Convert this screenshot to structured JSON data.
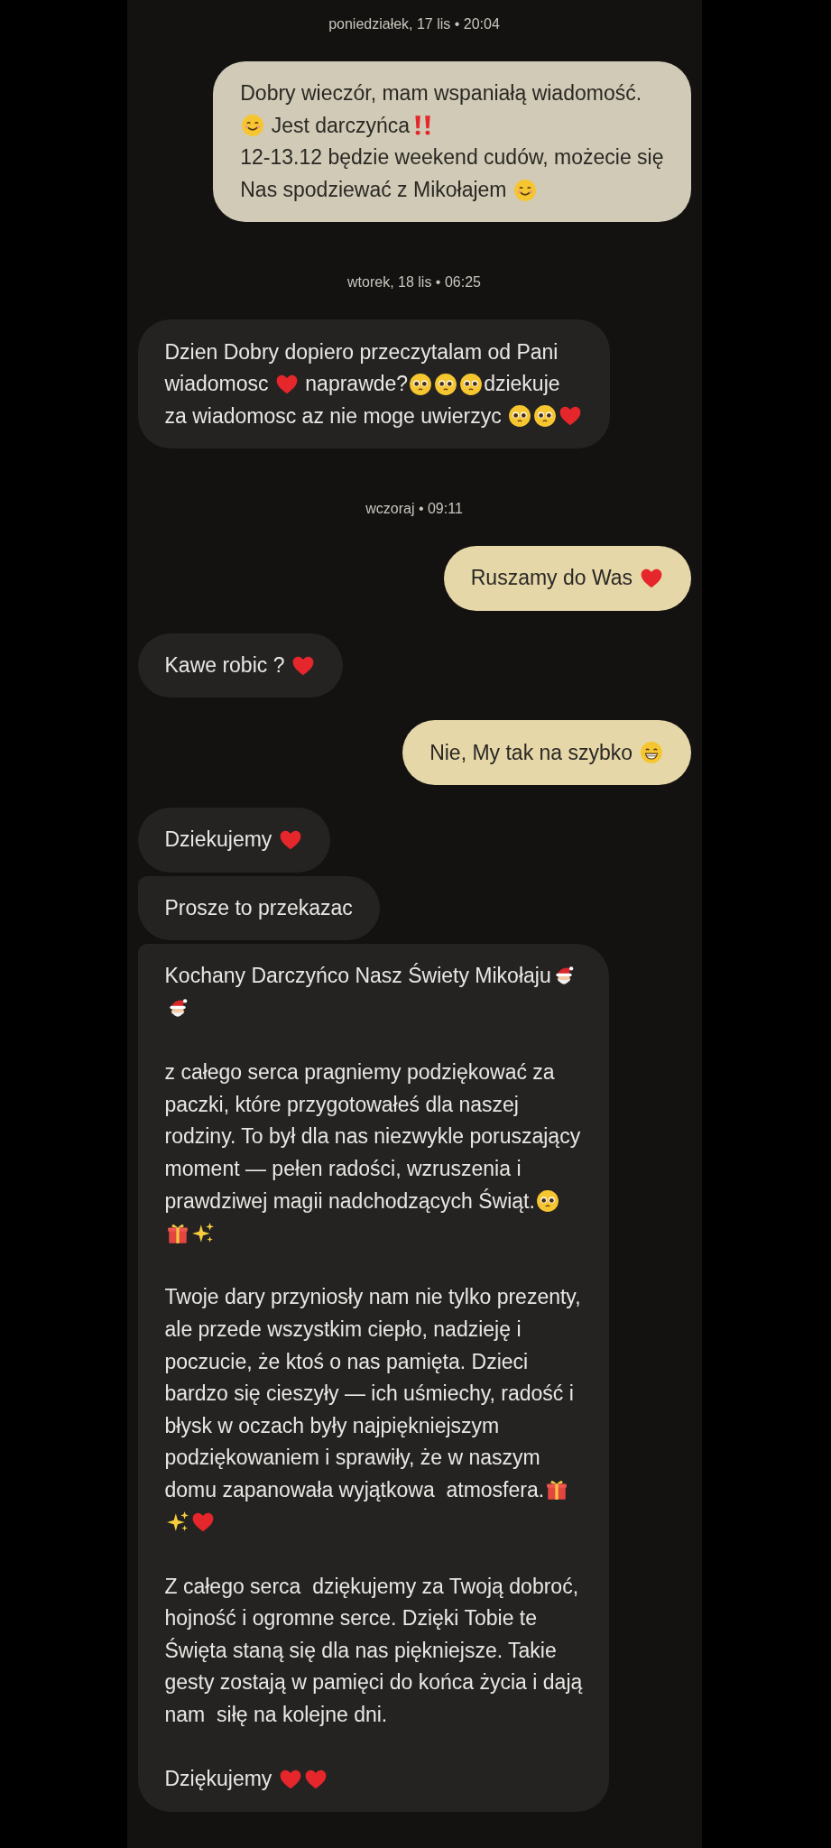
{
  "items": [
    {
      "kind": "date",
      "text": "poniedziałek, 17 lis • 20:04"
    },
    {
      "kind": "message",
      "outgoing": true,
      "color": "#d1cab6",
      "paragraphs": [
        [
          [
            {
              "kind": "text",
              "text": "Dobry wieczór, mam wspaniałą wiadomość."
            }
          ],
          [
            {
              "kind": "smile"
            },
            {
              "kind": "text",
              "text": " Jest darczyńca"
            },
            {
              "kind": "exclamation"
            }
          ],
          [
            {
              "kind": "text",
              "text": "12-13.12 będzie weekend cudów, możecie się"
            }
          ],
          [
            {
              "kind": "text",
              "text": "Nas spodziewać z Mikołajem "
            },
            {
              "kind": "smile"
            }
          ]
        ]
      ]
    },
    {
      "kind": "date",
      "text": "wtorek, 18 lis • 06:25"
    },
    {
      "kind": "message",
      "outgoing": false,
      "color": "#242322",
      "paragraphs": [
        [
          [
            {
              "kind": "text",
              "text": "Dzien Dobry dopiero przeczytalam od Pani"
            }
          ],
          [
            {
              "kind": "text",
              "text": "wiadomosc "
            },
            {
              "kind": "heart"
            },
            {
              "kind": "text",
              "text": " naprawde?"
            },
            {
              "kind": "pleading"
            },
            {
              "kind": "pleading"
            },
            {
              "kind": "pleading"
            },
            {
              "kind": "text",
              "text": "dziekuje"
            }
          ],
          [
            {
              "kind": "text",
              "text": "za wiadomosc az nie moge uwierzyc "
            },
            {
              "kind": "pleading"
            },
            {
              "kind": "pleading"
            },
            {
              "kind": "heart"
            }
          ]
        ]
      ]
    },
    {
      "kind": "date",
      "text": "wczoraj • 09:11"
    },
    {
      "kind": "message",
      "outgoing": true,
      "color": "#e6d7a9",
      "paragraphs": [
        [
          [
            {
              "kind": "text",
              "text": "Ruszamy do Was "
            },
            {
              "kind": "heart"
            }
          ]
        ]
      ]
    },
    {
      "kind": "message",
      "outgoing": false,
      "color": "#242322",
      "paragraphs": [
        [
          [
            {
              "kind": "text",
              "text": "Kawe robic ? "
            },
            {
              "kind": "heart"
            }
          ]
        ]
      ]
    },
    {
      "kind": "message",
      "outgoing": true,
      "color": "#e6d7a9",
      "paragraphs": [
        [
          [
            {
              "kind": "text",
              "text": "Nie, My tak na szybko "
            },
            {
              "kind": "grin"
            }
          ]
        ]
      ]
    },
    {
      "kind": "message",
      "outgoing": false,
      "color": "#242322",
      "paragraphs": [
        [
          [
            {
              "kind": "text",
              "text": "Dziekujemy "
            },
            {
              "kind": "heart"
            }
          ]
        ]
      ]
    },
    {
      "kind": "message",
      "outgoing": false,
      "color": "#242322",
      "paragraphs": [
        [
          [
            {
              "kind": "text",
              "text": "Prosze to przekazac"
            }
          ]
        ]
      ]
    },
    {
      "kind": "message",
      "outgoing": false,
      "color": "#242322",
      "paragraphs": [
        [
          [
            {
              "kind": "text",
              "text": "Kochany Darczyńco Nasz Świety Mikołaju"
            },
            {
              "kind": "santa"
            }
          ],
          [
            {
              "kind": "santa"
            }
          ]
        ],
        [
          [
            {
              "kind": "text",
              "text": "z całego serca pragniemy podziękować za"
            }
          ],
          [
            {
              "kind": "text",
              "text": "paczki, które przygotowałeś dla naszej"
            }
          ],
          [
            {
              "kind": "text",
              "text": "rodziny. To był dla nas niezwykle poruszający"
            }
          ],
          [
            {
              "kind": "text",
              "text": "moment — pełen radości, wzruszenia i"
            }
          ],
          [
            {
              "kind": "text",
              "text": "prawdziwej magii nadchodzących Świąt."
            },
            {
              "kind": "pleading"
            }
          ],
          [
            {
              "kind": "gift"
            },
            {
              "kind": "sparkles"
            }
          ]
        ],
        [
          [
            {
              "kind": "text",
              "text": "Twoje dary przyniosły nam nie tylko prezenty,"
            }
          ],
          [
            {
              "kind": "text",
              "text": "ale przede wszystkim ciepło, nadzieję i"
            }
          ],
          [
            {
              "kind": "text",
              "text": "poczucie, że ktoś o nas pamięta. Dzieci"
            }
          ],
          [
            {
              "kind": "text",
              "text": "bardzo się cieszyły — ich uśmiechy, radość i"
            }
          ],
          [
            {
              "kind": "text",
              "text": "błysk w oczach były najpiękniejszym"
            }
          ],
          [
            {
              "kind": "text",
              "text": "podziękowaniem i sprawiły, że w naszym"
            }
          ],
          [
            {
              "kind": "text",
              "text": "domu zapanowała wyjątkowa  atmosfera."
            },
            {
              "kind": "gift"
            }
          ],
          [
            {
              "kind": "sparkles"
            },
            {
              "kind": "heart"
            }
          ]
        ],
        [
          [
            {
              "kind": "text",
              "text": "Z całego serca  dziękujemy za Twoją dobroć,"
            }
          ],
          [
            {
              "kind": "text",
              "text": "hojność i ogromne serce. Dzięki Tobie te"
            }
          ],
          [
            {
              "kind": "text",
              "text": "Święta staną się dla nas piękniejsze. Takie"
            }
          ],
          [
            {
              "kind": "text",
              "text": "gesty zostają w pamięci do końca życia i dają"
            }
          ],
          [
            {
              "kind": "text",
              "text": "nam  siłę na kolejne dni."
            }
          ]
        ],
        [
          [
            {
              "kind": "text",
              "text": "Dziękujemy "
            },
            {
              "kind": "heart"
            },
            {
              "kind": "heart"
            }
          ]
        ]
      ]
    }
  ]
}
